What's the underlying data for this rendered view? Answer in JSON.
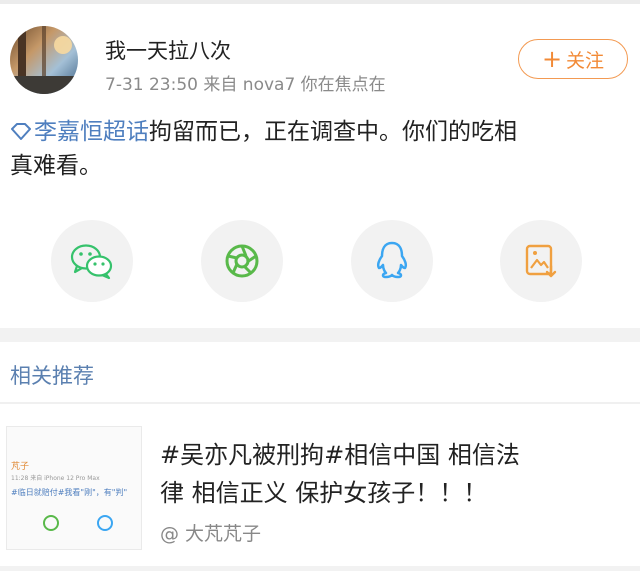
{
  "post": {
    "username": "我一天拉八次",
    "meta_time": "7-31 23:50",
    "meta_source": "来自 nova7 你在焦点在",
    "follow_label": "关注",
    "follow_plus": "+",
    "topic": "李嘉恒超话",
    "text_line1": "拘留而已，正在调查中。你们的吃相",
    "text_line2": "真难看。"
  },
  "share": {
    "items": [
      {
        "icon": "wechat-icon",
        "color": "#36c26c"
      },
      {
        "icon": "moments-icon",
        "color": "#59b94a"
      },
      {
        "icon": "qq-icon",
        "color": "#3ba6f2"
      },
      {
        "icon": "save-image-icon",
        "color": "#f0a040"
      }
    ]
  },
  "related": {
    "title": "相关推荐",
    "item": {
      "title_line1": "#吴亦凡被刑拘#相信中国 相信法",
      "title_line2": "律 相信正义 保护女孩子！！！",
      "author": "@ 大芃芃子",
      "thumb_name": "芃子",
      "thumb_meta": "11:28 来自 iPhone 12 Pro Max",
      "thumb_text": "#临日就赔付#我看\"刚\"，有\"判\""
    }
  }
}
